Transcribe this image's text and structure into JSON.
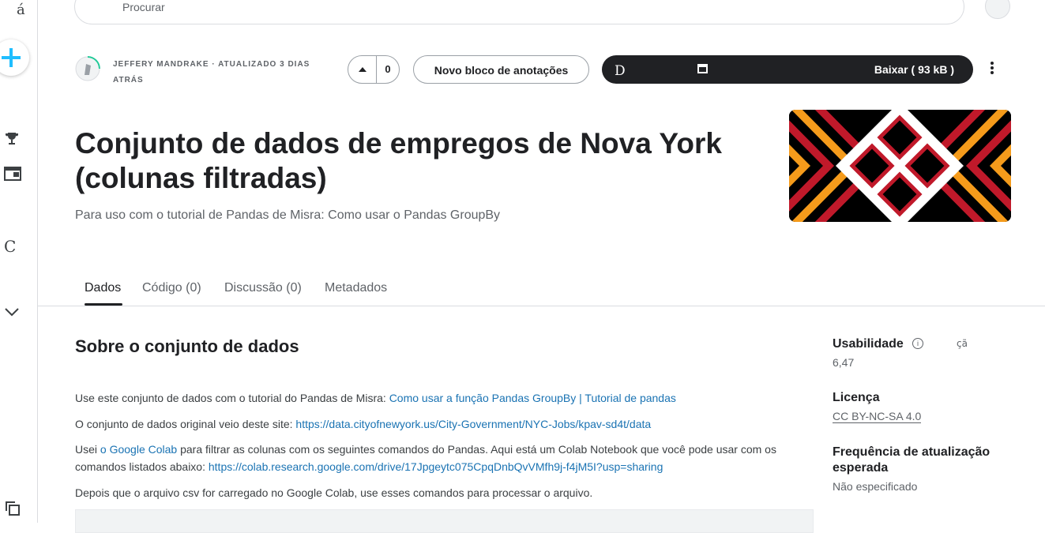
{
  "rail": {
    "top_glyph": "á",
    "mid_glyph": "C"
  },
  "search": {
    "placeholder": "Procurar"
  },
  "header": {
    "author": "JEFFERY MANDRAKE · ATUALIZADO 3 DIAS ATRÁS",
    "vote_count": "0",
    "new_notebook_label": "Novo bloco de anotações",
    "download_glyph": "D",
    "download_label": "Baixar ( 93 kB )"
  },
  "dataset": {
    "title": "Conjunto de dados de empregos de Nova York (colunas filtradas)",
    "subtitle": "Para uso com o tutorial de Pandas de Misra: Como usar o Pandas GroupBy"
  },
  "tabs": [
    {
      "label": "Dados",
      "active": true
    },
    {
      "label": "Código (0)",
      "active": false
    },
    {
      "label": "Discussão (0)",
      "active": false
    },
    {
      "label": "Metadados",
      "active": false
    }
  ],
  "about": {
    "heading": "Sobre o conjunto de dados",
    "p1_text": "Use este conjunto de dados com o tutorial do Pandas de Misra: ",
    "p1_link": "Como usar a função Pandas GroupBy | Tutorial de pandas",
    "p2_text": "O conjunto de dados original veio deste site: ",
    "p2_link": "https://data.cityofnewyork.us/City-Government/NYC-Jobs/kpav-sd4t/data",
    "p3_text_a": "Usei ",
    "p3_link_a": "o Google Colab",
    "p3_text_b": " para filtrar as colunas com os seguintes comandos do Pandas. Aqui está um Colab Notebook que você pode usar com os comandos listados abaixo: ",
    "p3_link_b": "https://colab.research.google.com/drive/17Jpgeytc075CpqDnbQvVMfh9j-f4jM5I?usp=sharing",
    "p4_text": "Depois que o arquivo csv for carregado no Google Colab, use esses comandos para processar o arquivo."
  },
  "sidebar": {
    "usability_label": "Usabilidade",
    "usability_glyph": "çã",
    "usability_value": "6,47",
    "license_label": "Licença",
    "license_value": "CC BY-NC-SA 4.0",
    "frequency_label": "Frequência de atualização esperada",
    "frequency_value": "Não especificado"
  },
  "colors": {
    "link": "#1a73b3",
    "dark": "#202124",
    "banner_orange": "#f59b1b",
    "banner_red": "#c0192a"
  }
}
